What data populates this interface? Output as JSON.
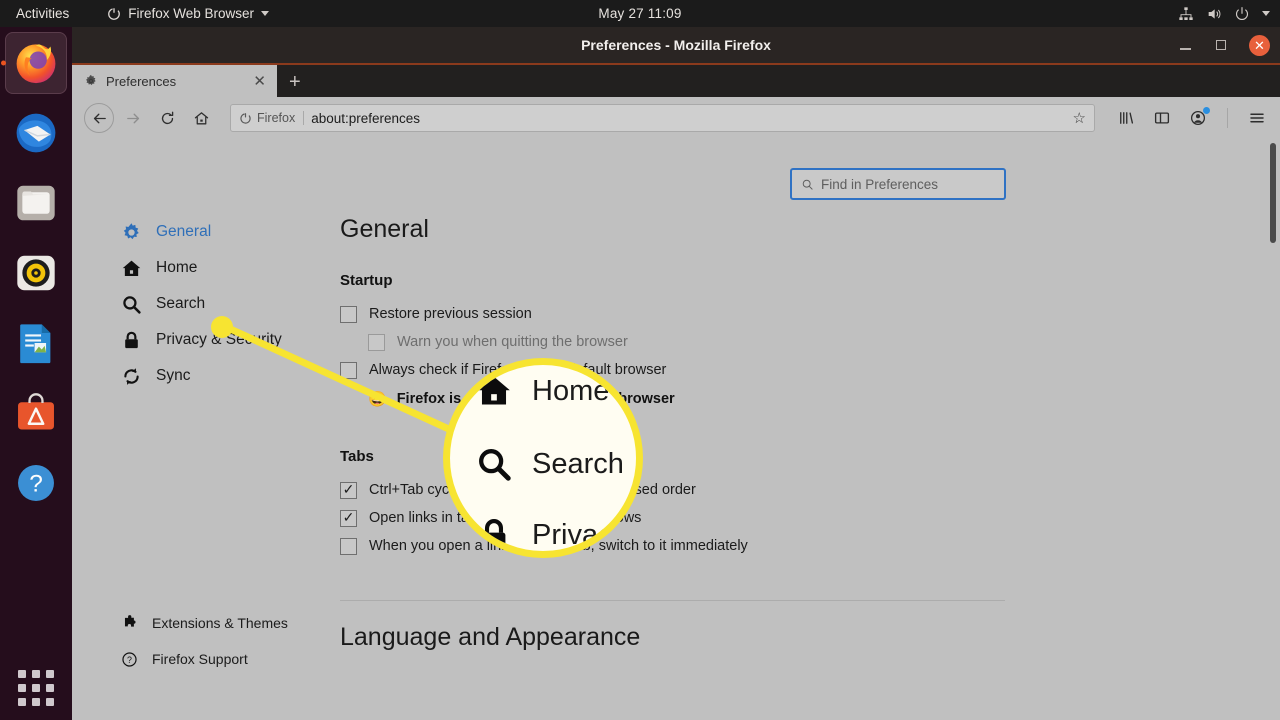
{
  "topbar": {
    "activities": "Activities",
    "app_name": "Firefox Web Browser",
    "clock": "May 27  11:09",
    "icons": [
      "network-icon",
      "volume-icon",
      "power-icon",
      "caret-down-icon"
    ]
  },
  "dock": {
    "items": [
      {
        "name": "firefox",
        "label": "Firefox Web Browser",
        "active": true
      },
      {
        "name": "thunderbird",
        "label": "Thunderbird Mail",
        "active": false
      },
      {
        "name": "files",
        "label": "Files",
        "active": false
      },
      {
        "name": "rhythmbox",
        "label": "Rhythmbox",
        "active": false
      },
      {
        "name": "libreoffice-writer",
        "label": "LibreOffice Writer",
        "active": false
      },
      {
        "name": "ubuntu-software",
        "label": "Ubuntu Software",
        "active": false
      },
      {
        "name": "help",
        "label": "Help",
        "active": false
      }
    ],
    "app_grid_label": "Show Applications"
  },
  "window": {
    "title": "Preferences - Mozilla Firefox",
    "minimize": "–",
    "maximize": "□",
    "close": "✕"
  },
  "tabs": {
    "items": [
      {
        "title": "Preferences",
        "icon": "gear-icon",
        "close": "✕"
      }
    ],
    "new_tab": "+"
  },
  "navbar": {
    "back": "←",
    "forward": "→",
    "reload": "↻",
    "home": "⌂",
    "url_chip": "Firefox",
    "url": "about:preferences",
    "bookmark_star": "☆",
    "library": "library-icon",
    "sidebar": "sidebar-icon",
    "account": "account-icon",
    "menu": "☰"
  },
  "search": {
    "placeholder": "Find in Preferences",
    "icon": "search-icon"
  },
  "sidebar": {
    "items": [
      {
        "label": "General",
        "icon": "gear-icon",
        "active": true
      },
      {
        "label": "Home",
        "icon": "home-icon",
        "active": false
      },
      {
        "label": "Search",
        "icon": "search-icon",
        "active": false
      },
      {
        "label": "Privacy & Security",
        "icon": "lock-icon",
        "active": false
      },
      {
        "label": "Sync",
        "icon": "sync-icon",
        "active": false
      }
    ],
    "bottom_items": [
      {
        "label": "Extensions & Themes",
        "icon": "puzzle-icon"
      },
      {
        "label": "Firefox Support",
        "icon": "question-circle-icon"
      }
    ]
  },
  "main": {
    "page_title": "General",
    "startup": {
      "heading": "Startup",
      "options": [
        {
          "label": "Restore previous session",
          "underline": "s",
          "checked": false,
          "disabled": false
        },
        {
          "label": "Warn you when quitting the browser",
          "underline": "",
          "checked": false,
          "disabled": true
        },
        {
          "label": "Always check if Firefox is your default browser",
          "underline": "y",
          "checked": false,
          "disabled": false
        }
      ],
      "default_status": "Firefox is currently your default browser",
      "default_status_emoji": "😃"
    },
    "tabs_section": {
      "heading": "Tabs",
      "options": [
        {
          "label": "Ctrl+Tab cycles through tabs in recently used order",
          "underline": "T",
          "checked": true
        },
        {
          "label": "Open links in tabs instead of new windows",
          "underline": "w",
          "checked": true
        },
        {
          "label": "When you open a link in a new tab, switch to it immediately",
          "underline": "h",
          "checked": false
        }
      ]
    },
    "language_heading": "Language and Appearance"
  },
  "callout": {
    "color": "#f7e431",
    "target_label": "Search",
    "magnified_items": [
      {
        "label": "Home",
        "icon": "home-icon"
      },
      {
        "label": "Search",
        "icon": "search-icon"
      },
      {
        "label": "Privacy",
        "icon": "lock-icon"
      }
    ]
  }
}
